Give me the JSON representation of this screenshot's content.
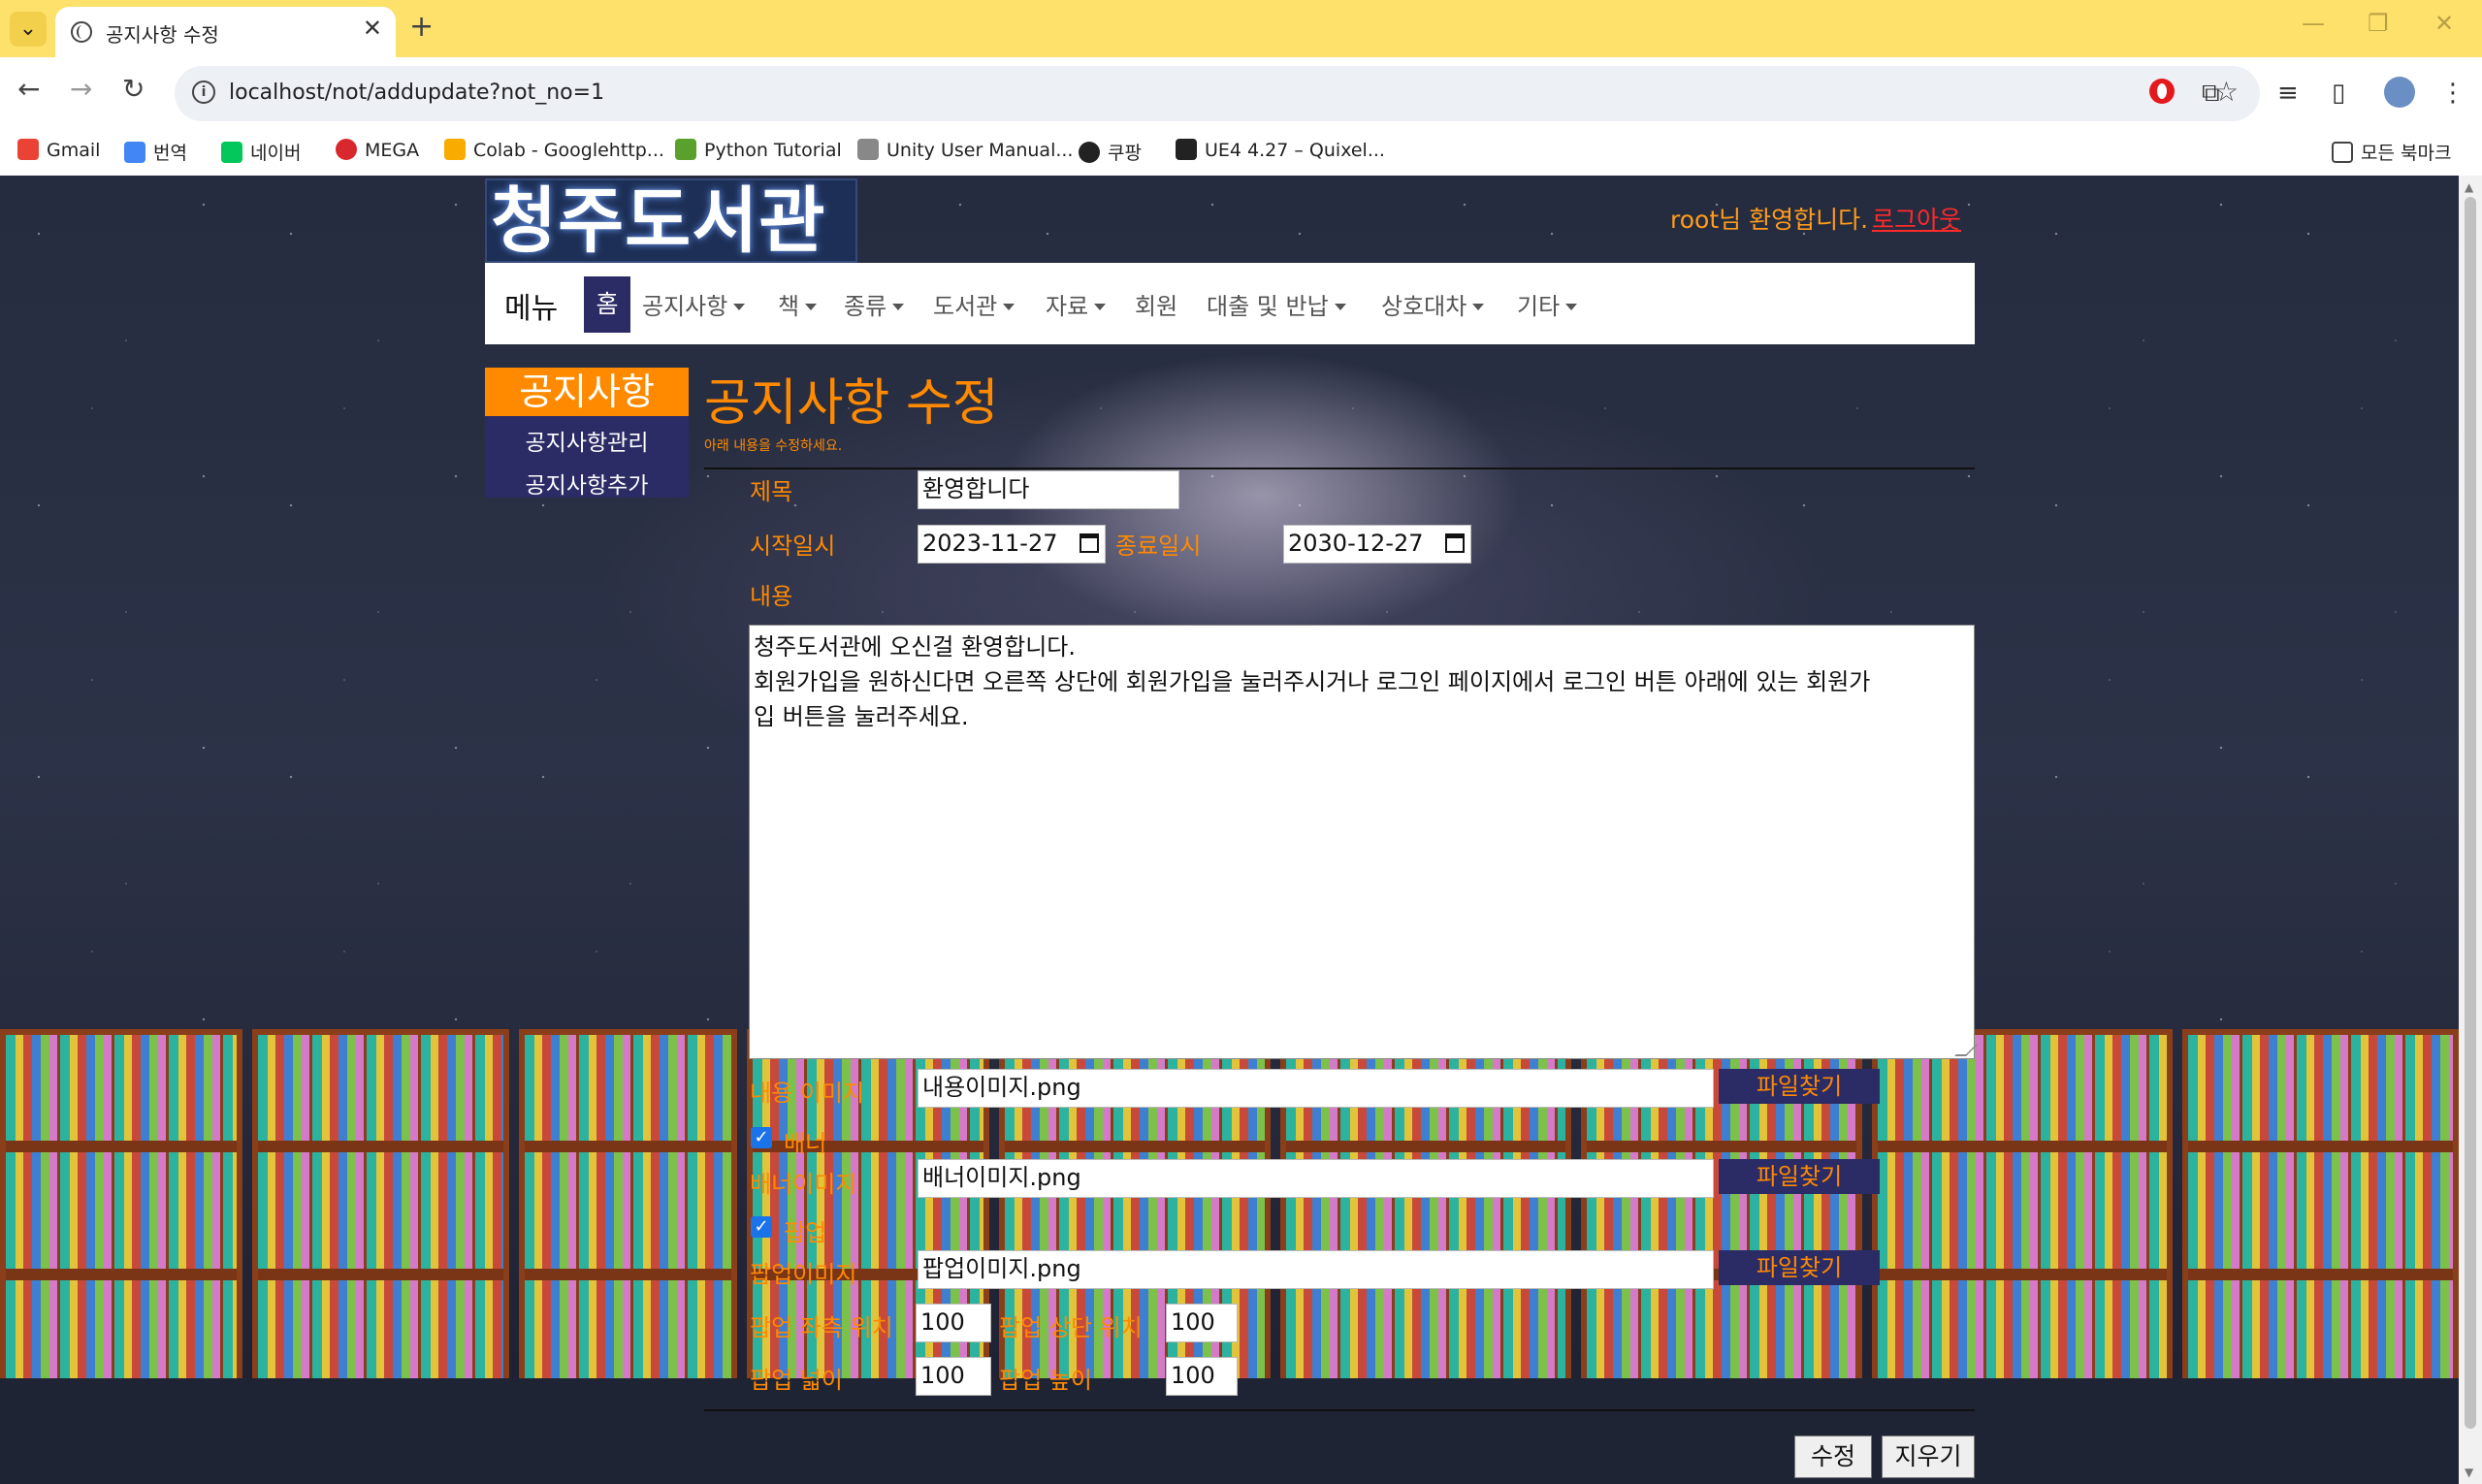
{
  "browser": {
    "tab_title": "공지사항 수정",
    "url": "localhost/not/addupdate?not_no=1",
    "bookmarks": [
      "Gmail",
      "번역",
      "네이버",
      "MEGA",
      "Colab - Googlehttp...",
      "Python Tutorial",
      "Unity User Manual...",
      "쿠팡",
      "UE4 4.27 – Quixel..."
    ],
    "all_bookmarks": "모든 북마크"
  },
  "header": {
    "logo": "청주도서관",
    "welcome": "root님 환영합니다.",
    "logout": "로그아웃"
  },
  "nav": {
    "brand": "메뉴",
    "home": "홈",
    "items": [
      "공지사항",
      "책",
      "종류",
      "도서관",
      "자료",
      "회원",
      "대출 및 반납",
      "상호대차",
      "기타"
    ]
  },
  "sidebar": {
    "title": "공지사항",
    "links": [
      "공지사항관리",
      "공지사항추가"
    ]
  },
  "form": {
    "heading": "공지사항 수정",
    "subheading": "아래 내용을 수정하세요.",
    "title_label": "제목",
    "title_value": "환영합니다",
    "start_label": "시작일시",
    "start_value": "2023-11-27",
    "end_label": "종료일시",
    "end_value": "2030-12-27",
    "content_label": "내용",
    "content_lines": [
      "청주도서관에 오신걸 환영합니다.",
      "회원가입을 원하신다면 오른쪽 상단에 회원가입을 눌러주시거나 로그인 페이지에서 로그인 버튼 아래에 있는 회원가",
      "입 버튼을 눌러주세요."
    ],
    "content_image_label": "내용 이미지",
    "content_image_value": "내용이미지.png",
    "banner_label": "배너",
    "banner_image_label": "배너이미지",
    "banner_image_value": "배너이미지.png",
    "popup_label": "팝업",
    "popup_image_label": "팝업이미지",
    "popup_image_value": "팝업이미지.png",
    "file_button": "파일찾기",
    "popup_left_label": "팝업 좌측 위치",
    "popup_left_value": "100",
    "popup_top_label": "팝업 상단 위치",
    "popup_top_value": "100",
    "popup_width_label": "팝업 넓이",
    "popup_width_value": "100",
    "popup_height_label": "팝업 높이",
    "popup_height_value": "100",
    "submit": "수정",
    "reset": "지우기"
  },
  "colors": {
    "accent": "#ff8a00",
    "nav_dark": "#2b2b66",
    "logout": "#ff2a2a"
  }
}
